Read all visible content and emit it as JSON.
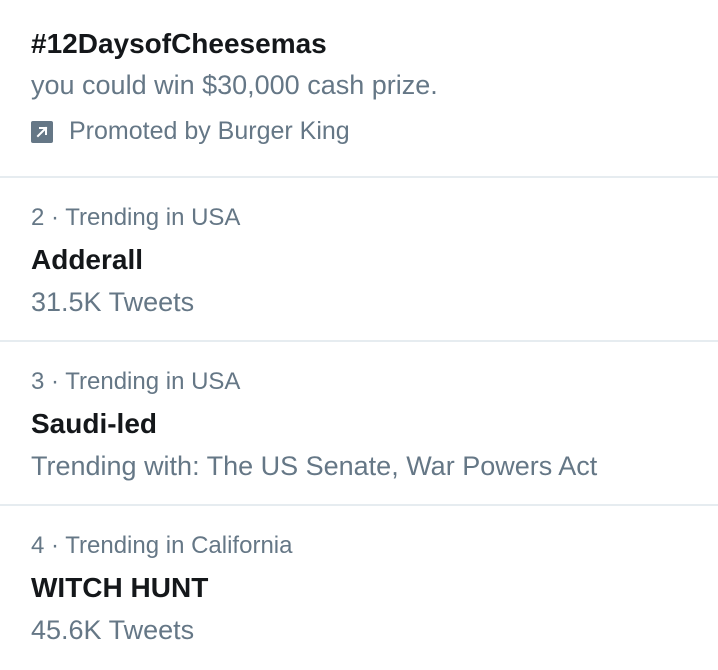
{
  "colors": {
    "primary_text": "#14171a",
    "secondary_text": "#657786",
    "divider": "#e6ecf0",
    "background": "#ffffff"
  },
  "promoted": {
    "name": "#12DaysofCheesemas",
    "description": "you could win $30,000 cash prize.",
    "promoted_by": "Promoted by Burger King",
    "icon": "promoted-arrow-icon"
  },
  "trends": [
    {
      "context": "2 · Trending in USA",
      "name": "Adderall",
      "detail": "31.5K Tweets"
    },
    {
      "context": "3 · Trending in USA",
      "name": "Saudi-led",
      "detail": "Trending with: The US Senate, War Powers Act"
    },
    {
      "context": "4 · Trending in California",
      "name": "WITCH HUNT",
      "detail": "45.6K Tweets"
    }
  ]
}
